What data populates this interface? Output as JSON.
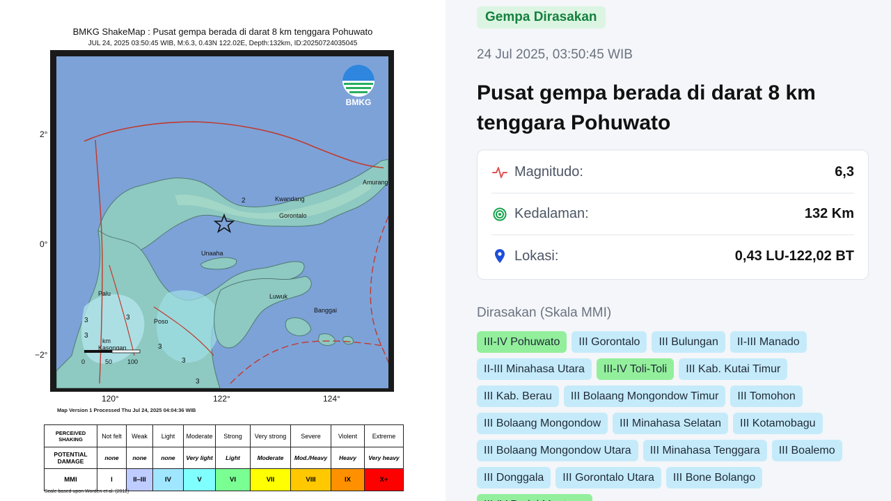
{
  "shakemap": {
    "title": "BMKG ShakeMap : Pusat gempa berada di darat 8 km tenggara Pohuwato",
    "subtitle": "JUL 24, 2025 03:50:45 WIB, M:6.3, 0.43N 122.02E, Depth:132km, ID:20250724035045",
    "logo_text": "BMKG",
    "lat_ticks": [
      "2°",
      "0°",
      "−2°"
    ],
    "lon_ticks": [
      "120°",
      "122°",
      "124°"
    ],
    "places": [
      "Kwandang",
      "Gorontalo",
      "Amurang",
      "Unaaha",
      "Luwuk",
      "Banggai",
      "Palu",
      "Poso",
      "Kasongan"
    ],
    "intensity_labels": [
      "2",
      "3",
      "3",
      "3",
      "3",
      "3",
      "3"
    ],
    "scale_bar": {
      "unit": "km",
      "ticks": [
        "0",
        "50",
        "100"
      ]
    },
    "map_version": "Map Version 1 Processed Thu Jul 24, 2025 04:04:36 WIB",
    "scale_note": "Scale based upon Worden et al. (2011)",
    "legend": {
      "row_headers": [
        "PERCEIVED SHAKING",
        "POTENTIAL DAMAGE",
        "MMI"
      ],
      "shaking": [
        "Not felt",
        "Weak",
        "Light",
        "Moderate",
        "Strong",
        "Very strong",
        "Severe",
        "Violent",
        "Extreme"
      ],
      "damage": [
        "none",
        "none",
        "none",
        "Very light",
        "Light",
        "Moderate",
        "Mod./Heavy",
        "Heavy",
        "Very heavy"
      ],
      "mmi": [
        "I",
        "II–III",
        "IV",
        "V",
        "VI",
        "VII",
        "VIII",
        "IX",
        "X+"
      ],
      "mmi_colors": [
        "#ffffff",
        "#bfccff",
        "#a0e6ff",
        "#80ffff",
        "#7aff93",
        "#ffff00",
        "#ffc800",
        "#ff9100",
        "#ff0000"
      ]
    }
  },
  "event": {
    "felt_badge": "Gempa Dirasakan",
    "time": "24 Jul 2025, 03:50:45 WIB",
    "title": "Pusat gempa berada di darat 8 km tenggara Pohuwato",
    "magnitude_label": "Magnitudo:",
    "magnitude_value": "6,3",
    "depth_label": "Kedalaman:",
    "depth_value": "132 Km",
    "location_label": "Lokasi:",
    "location_value": "0,43 LU-122,02 BT",
    "felt_heading": "Dirasakan (Skala MMI)",
    "felt_areas": [
      {
        "label": "III-IV Pohuwato",
        "highlight": true
      },
      {
        "label": "III Gorontalo",
        "highlight": false
      },
      {
        "label": "III Bulungan",
        "highlight": false
      },
      {
        "label": "II-III Manado",
        "highlight": false
      },
      {
        "label": "II-III Minahasa Utara",
        "highlight": false
      },
      {
        "label": "III-IV Toli-Toli",
        "highlight": true
      },
      {
        "label": "III Kab. Kutai Timur",
        "highlight": false
      },
      {
        "label": "III Kab. Berau",
        "highlight": false
      },
      {
        "label": "III Bolaang Mongondow Timur",
        "highlight": false
      },
      {
        "label": "III Tomohon",
        "highlight": false
      },
      {
        "label": "III Bolaang Mongondow",
        "highlight": false
      },
      {
        "label": "III Minahasa Selatan",
        "highlight": false
      },
      {
        "label": "III Kotamobagu",
        "highlight": false
      },
      {
        "label": "III Bolaang Mongondow Utara",
        "highlight": false
      },
      {
        "label": "III Minahasa Tenggara",
        "highlight": false
      },
      {
        "label": "III Boalemo",
        "highlight": false
      },
      {
        "label": "III Donggala",
        "highlight": false
      },
      {
        "label": "III Gorontalo Utara",
        "highlight": false
      },
      {
        "label": "III Bone Bolango",
        "highlight": false
      },
      {
        "label": "III-IV Parigi Moutong",
        "highlight": true
      }
    ],
    "colors": {
      "chip": "#c5ebfa",
      "chip_highlight": "#93ef9c",
      "badge_text": "#15803d"
    }
  }
}
